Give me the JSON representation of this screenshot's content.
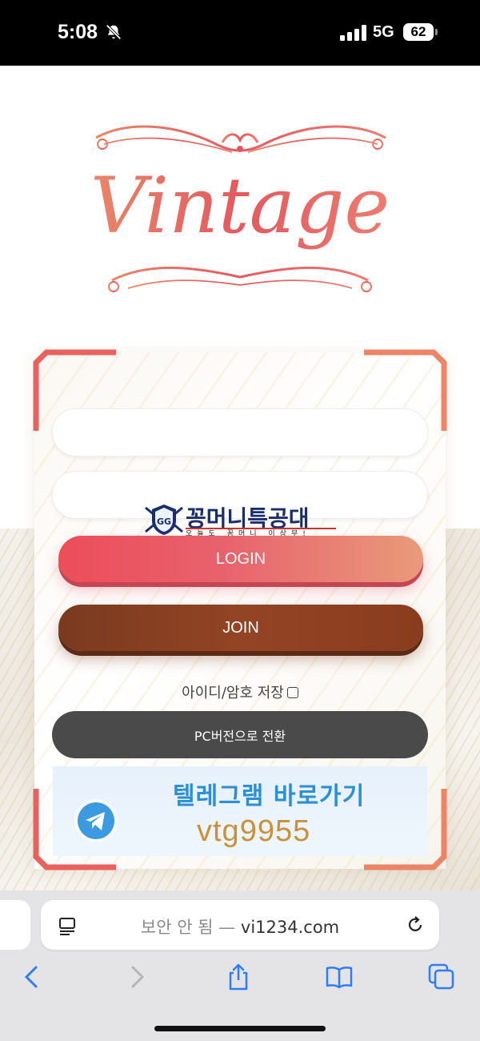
{
  "status_bar": {
    "time": "5:08",
    "network": "5G",
    "battery": "62"
  },
  "logo": {
    "text": "Vintage"
  },
  "login_form": {
    "id_value": "",
    "password_value": "",
    "login_label": "LOGIN",
    "join_label": "JOIN",
    "remember_label": "아이디/암호 저장",
    "pc_version_label": "PC버전으로 전환"
  },
  "brand_badge": {
    "title": "꽁머니특공대",
    "subtitle": "오늘도 꽁머니 이상무!"
  },
  "telegram_banner": {
    "title": "텔레그램 바로가기",
    "id": "vtg9955"
  },
  "browser": {
    "security_label": "보안 안 됨",
    "separator": "—",
    "domain": "vi1234.com"
  },
  "colors": {
    "login_button": "#ec4d59",
    "join_button": "#8a3c1e",
    "pc_button": "#4a4a4a",
    "logo": "#e4675e",
    "telegram_title": "#2a8fd6",
    "telegram_id": "#c8923c"
  }
}
